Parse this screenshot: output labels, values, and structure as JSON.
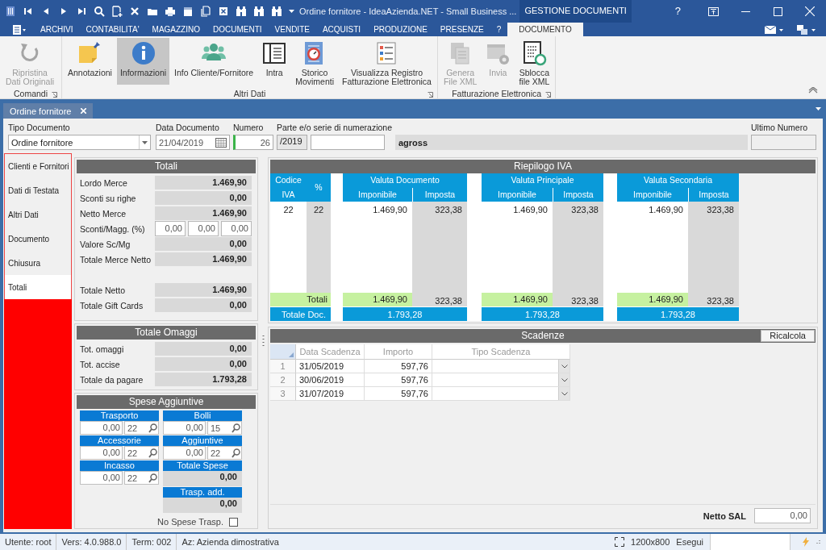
{
  "window": {
    "title": "Ordine fornitore - IdeaAzienda.NET - Small Business ...",
    "context_tab": "GESTIONE DOCUMENTI",
    "help": "?"
  },
  "menu_tabs": [
    {
      "label": "ARCHIVI",
      "selected": false
    },
    {
      "label": "CONTABILITA'",
      "selected": false
    },
    {
      "label": "MAGAZZINO",
      "selected": false
    },
    {
      "label": "DOCUMENTI",
      "selected": false
    },
    {
      "label": "VENDITE",
      "selected": false
    },
    {
      "label": "ACQUISTI",
      "selected": false
    },
    {
      "label": "PRODUZIONE",
      "selected": false
    },
    {
      "label": "PRESENZE",
      "selected": false
    },
    {
      "label": "?",
      "selected": false
    },
    {
      "label": "DOCUMENTO",
      "selected": true
    }
  ],
  "ribbon_groups": [
    {
      "label": "Comandi",
      "buttons": [
        {
          "label": "Ripristina\nDati Originali",
          "disabled": true,
          "selected": false
        }
      ]
    },
    {
      "label": "Altri Dati",
      "buttons": [
        {
          "label": "Annotazioni",
          "disabled": false,
          "selected": false
        },
        {
          "label": "Informazioni",
          "disabled": false,
          "selected": true
        },
        {
          "label": "Info Cliente/Fornitore",
          "disabled": false,
          "selected": false
        },
        {
          "label": "Intra",
          "disabled": false,
          "selected": false
        },
        {
          "label": "Storico\nMovimenti",
          "disabled": false,
          "selected": false
        },
        {
          "label": "Visualizza Registro\nFatturazione Elettronica",
          "disabled": false,
          "selected": false
        }
      ]
    },
    {
      "label": "Fatturazione Elettronica",
      "buttons": [
        {
          "label": "Genera\nFile XML",
          "disabled": true,
          "selected": false
        },
        {
          "label": "Invia",
          "disabled": true,
          "selected": false
        },
        {
          "label": "Sblocca\nfile XML",
          "disabled": false,
          "selected": false
        }
      ]
    }
  ],
  "document_tabs": [
    {
      "label": "Ordine fornitore",
      "selected": true
    }
  ],
  "document_header": {
    "tipo_documento": {
      "label": "Tipo Documento",
      "value": "Ordine fornitore"
    },
    "data_documento": {
      "label": "Data Documento",
      "value": "21/04/2019"
    },
    "numero": {
      "label": "Numero",
      "value": "26"
    },
    "serie": {
      "label": "Parte e/o serie di numerazione",
      "prefix": "/2019"
    },
    "series_description": "agross",
    "ultimo_numero": {
      "label": "Ultimo Numero"
    }
  },
  "sections": [
    {
      "label": "Clienti e Fornitori",
      "selected": false
    },
    {
      "label": "Dati di Testata",
      "selected": false
    },
    {
      "label": "Altri Dati",
      "selected": false
    },
    {
      "label": "Documento",
      "selected": false
    },
    {
      "label": "Chiusura",
      "selected": false
    },
    {
      "label": "Totali",
      "selected": true
    }
  ],
  "totali": {
    "title": "Totali",
    "rows": [
      {
        "kind": "value",
        "label": "Lordo Merce",
        "value": "1.469,90"
      },
      {
        "kind": "value",
        "label": "Sconti su righe",
        "value": "0,00"
      },
      {
        "kind": "value",
        "label": "Netto Merce",
        "value": "1.469,90"
      },
      {
        "kind": "inputs",
        "label": "Sconti/Magg. (%)",
        "values": [
          "0,00",
          "0,00",
          "0,00"
        ]
      },
      {
        "kind": "value",
        "label": "Valore Sc/Mg",
        "value": "0,00"
      },
      {
        "kind": "value",
        "label": "Totale Merce Netto",
        "value": "1.469,90"
      }
    ],
    "net_rows": [
      {
        "kind": "value",
        "label": "Totale Netto",
        "value": "1.469,90"
      },
      {
        "kind": "value",
        "label": "Totale Gift Cards",
        "value": "0,00"
      }
    ]
  },
  "totale_omaggi": {
    "title": "Totale Omaggi",
    "rows": [
      {
        "kind": "value",
        "label": "Tot. omaggi",
        "value": "0,00"
      },
      {
        "kind": "value",
        "label": "Tot. accise",
        "value": "0,00"
      },
      {
        "kind": "value",
        "label": "Totale da pagare",
        "value": "1.793,28"
      }
    ]
  },
  "spese_aggiuntive": {
    "title": "Spese Aggiuntive",
    "items": [
      {
        "kind": "input",
        "label": "Trasporto",
        "value": "0,00",
        "iva": "22"
      },
      {
        "kind": "input",
        "label": "Bolli",
        "value": "0,00",
        "iva": "15"
      },
      {
        "kind": "input",
        "label": "Accessorie",
        "value": "0,00",
        "iva": "22"
      },
      {
        "kind": "input",
        "label": "Aggiuntive",
        "value": "0,00",
        "iva": "22"
      },
      {
        "kind": "input",
        "label": "Incasso",
        "value": "0,00",
        "iva": "22"
      },
      {
        "kind": "total",
        "label": "Totale Spese",
        "value": "0,00"
      },
      {
        "kind": "total",
        "label": "Trasp. add.",
        "value": "0,00"
      }
    ],
    "no_spese_trasp": {
      "label": "No Spese Trasp.",
      "checked": false
    }
  },
  "riepilogo_iva": {
    "title": "Riepilogo IVA",
    "codice_label": "Codice",
    "iva_label": "IVA",
    "percent_label": "%",
    "rows": [
      {
        "codice": "22",
        "percent": "22"
      }
    ],
    "totals_label": "Totali",
    "total_doc_label": "Totale Doc.",
    "groups": [
      {
        "title": "Valuta Documento",
        "imponibile_label": "Imponibile",
        "imposta_label": "Imposta",
        "values": [
          {
            "imponibile": "1.469,90",
            "imposta": "323,38"
          }
        ],
        "total_imponibile": "1.469,90",
        "total_imposta": "323,38",
        "total_doc": "1.793,28"
      },
      {
        "title": "Valuta Principale",
        "imponibile_label": "Imponibile",
        "imposta_label": "Imposta",
        "values": [
          {
            "imponibile": "1.469,90",
            "imposta": "323,38"
          }
        ],
        "total_imponibile": "1.469,90",
        "total_imposta": "323,38",
        "total_doc": "1.793,28"
      },
      {
        "title": "Valuta Secondaria",
        "imponibile_label": "Imponibile",
        "imposta_label": "Imposta",
        "values": [
          {
            "imponibile": "1.469,90",
            "imposta": "323,38"
          }
        ],
        "total_imponibile": "1.469,90",
        "total_imposta": "323,38",
        "total_doc": "1.793,28"
      }
    ]
  },
  "scadenze": {
    "title": "Scadenze",
    "recalc_button": "Ricalcola",
    "columns": [
      "Data Scadenza",
      "Importo",
      "Tipo Scadenza"
    ],
    "rows": [
      {
        "number": "1",
        "data": "31/05/2019",
        "importo": "597,76"
      },
      {
        "number": "2",
        "data": "30/06/2019",
        "importo": "597,76"
      },
      {
        "number": "3",
        "data": "31/07/2019",
        "importo": "597,76"
      }
    ],
    "netto_sal": {
      "label": "Netto SAL",
      "value": "0,00"
    }
  },
  "status_bar": {
    "items": [
      "Utente: root",
      "Vers: 4.0.988.0",
      "Term: 002",
      "Az: Azienda dimostrativa"
    ],
    "resolution": "1200x800",
    "run_label": "Esegui"
  }
}
